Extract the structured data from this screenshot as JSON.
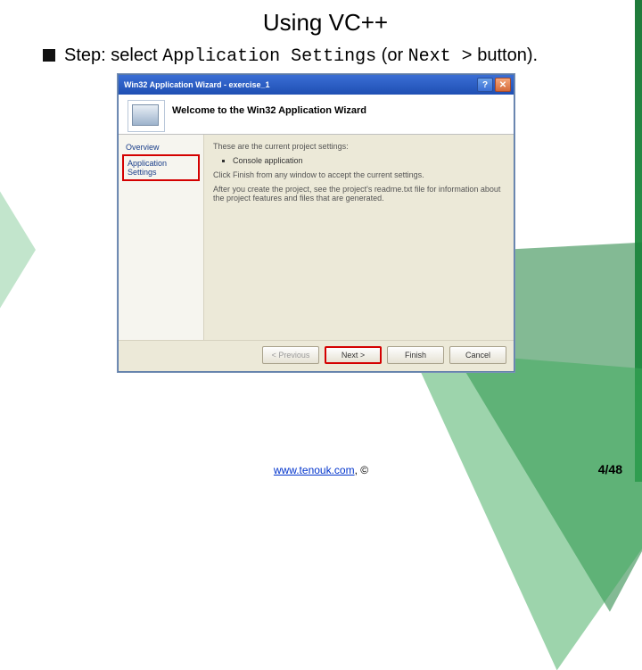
{
  "title": "Using VC++",
  "bullet": {
    "pre": "Step: select ",
    "code1": "Application Settings",
    "mid": " (or ",
    "code2": "Next >",
    "post": " button)."
  },
  "wizard": {
    "titlebar": "Win32 Application Wizard - exercise_1",
    "banner_title": "Welcome to the Win32 Application Wizard",
    "side": {
      "overview": "Overview",
      "appsettings": "Application Settings"
    },
    "content": {
      "l1": "These are the current project settings:",
      "li1": "Console application",
      "l2": "Click Finish from any window to accept the current settings.",
      "l3": "After you create the project, see the project's readme.txt file for information about the project features and files that are generated."
    },
    "buttons": {
      "prev": "< Previous",
      "next": "Next >",
      "finish": "Finish",
      "cancel": "Cancel"
    }
  },
  "footer": {
    "link": "www.tenouk.com",
    "copy": ", ©"
  },
  "pagenum": "4/48"
}
